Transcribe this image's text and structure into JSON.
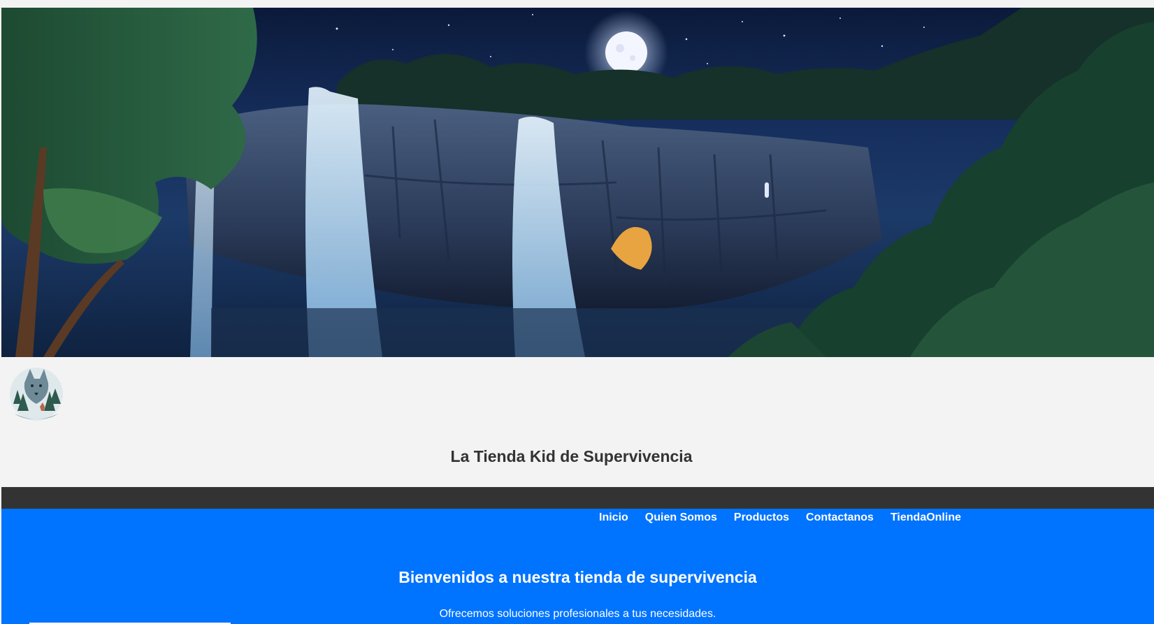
{
  "header": {
    "site_title": "La Tienda Kid de Supervivencia"
  },
  "hero": {
    "image_icon": "night-waterfall-landscape"
  },
  "logo": {
    "icon": "wolf-forest-logo-icon"
  },
  "nav": {
    "items": [
      {
        "label": "Inicio"
      },
      {
        "label": "Quien Somos"
      },
      {
        "label": "Productos"
      },
      {
        "label": "Contactanos"
      },
      {
        "label": "TiendaOnline"
      }
    ]
  },
  "main": {
    "welcome_heading": "Bienvenidos a nuestra tienda de supervivencia",
    "tagline": "Ofrecemos soluciones profesionales a tus necesidades."
  },
  "colors": {
    "accent_blue": "#0073ff",
    "dark_bar": "#333333",
    "background": "#f3f3f3",
    "title_text": "#333333"
  }
}
